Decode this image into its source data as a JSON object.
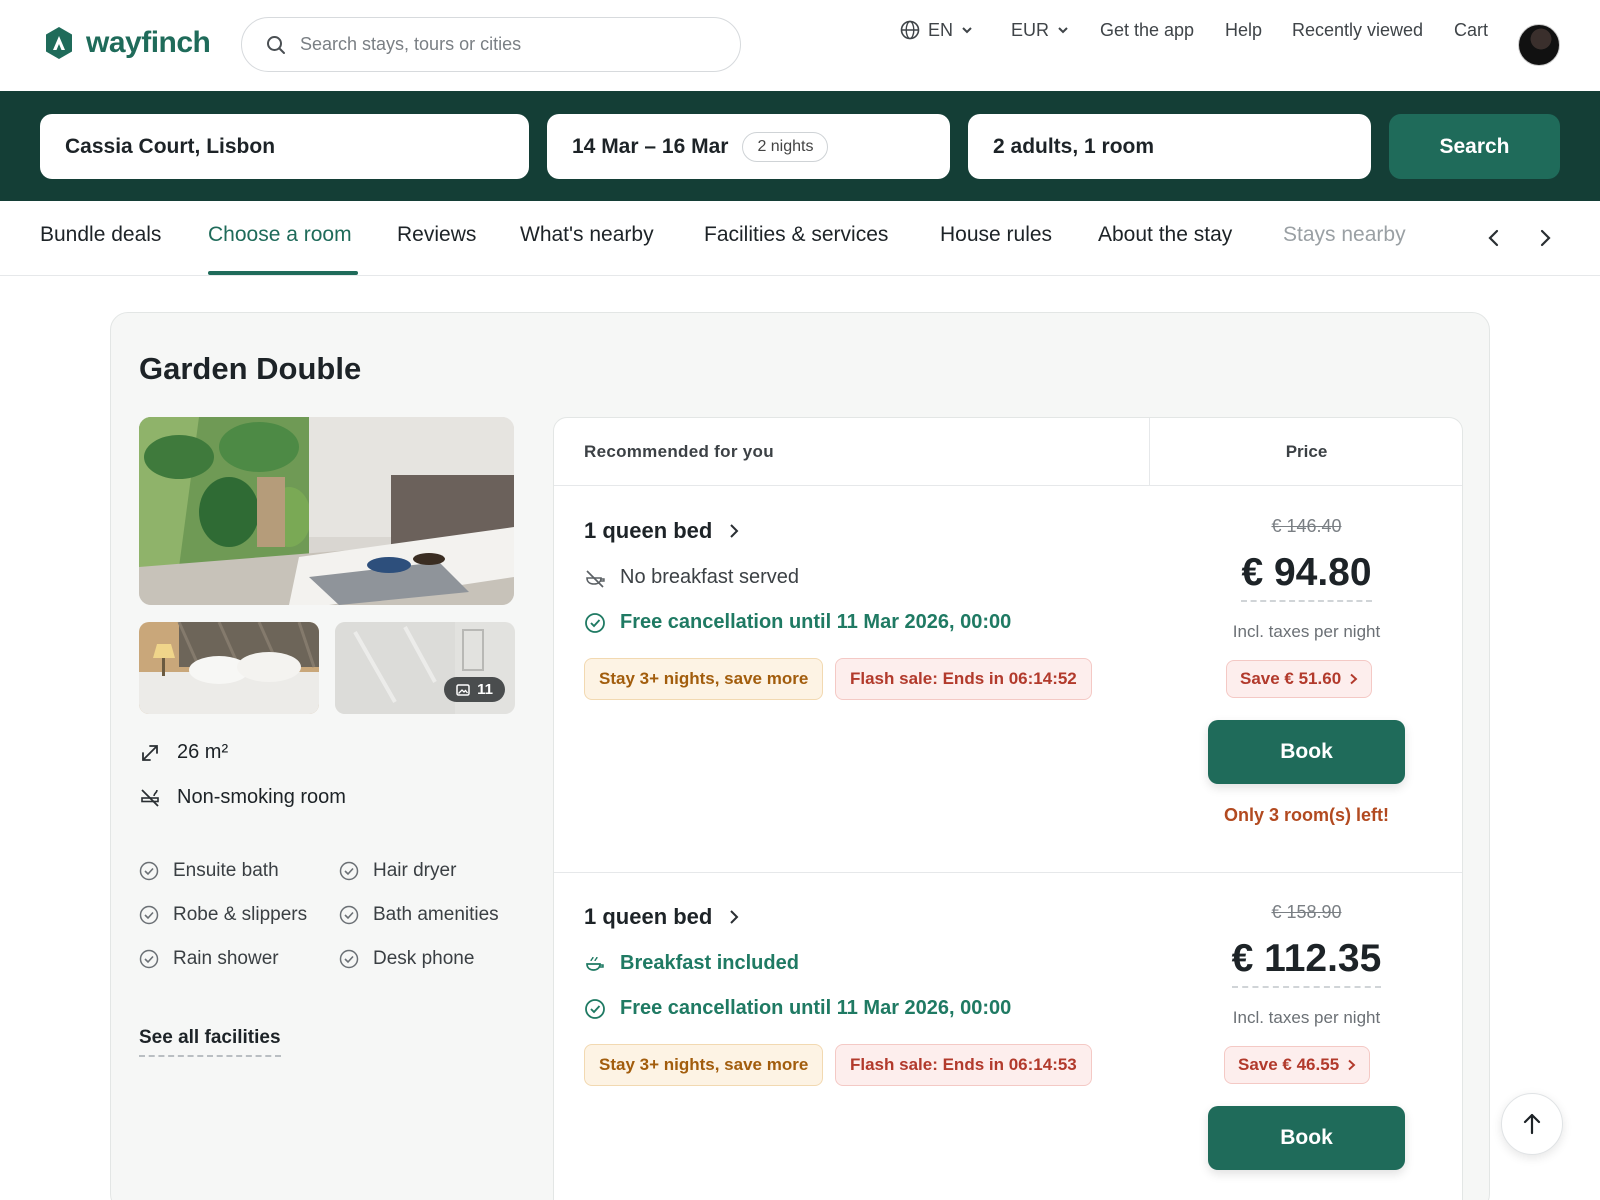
{
  "brand": {
    "name": "wayfinch",
    "color": "#1f6b5a"
  },
  "search": {
    "placeholder": "Search stays, tours or cities"
  },
  "top_nav": {
    "language": "EN",
    "currency": "EUR",
    "get_app": "Get the app",
    "help": "Help",
    "recently_viewed": "Recently viewed",
    "cart": "Cart"
  },
  "booking_bar": {
    "location": "Cassia Court, Lisbon",
    "dates": "14 Mar – 16 Mar",
    "nights": "2 nights",
    "guests": "2 adults, 1 room",
    "search_label": "Search"
  },
  "tabs": [
    {
      "label": "Bundle deals",
      "active": false
    },
    {
      "label": "Choose a room",
      "active": true
    },
    {
      "label": "Reviews",
      "active": false
    },
    {
      "label": "What's nearby",
      "active": false
    },
    {
      "label": "Facilities & services",
      "active": false
    },
    {
      "label": "House rules",
      "active": false
    },
    {
      "label": "About the stay",
      "active": false
    },
    {
      "label": "Stays nearby",
      "active": false
    }
  ],
  "room": {
    "title": "Garden Double",
    "photo_count": "11",
    "size": "26 m²",
    "smoking": "Non-smoking room",
    "facilities": [
      "Ensuite bath",
      "Hair dryer",
      "Robe & slippers",
      "Bath amenities",
      "Rain shower",
      "Desk phone"
    ],
    "see_all": "See all facilities"
  },
  "offers_header": {
    "recommended": "Recommended for you",
    "price": "Price"
  },
  "offers": [
    {
      "bed": "1 queen bed",
      "breakfast": "No breakfast served",
      "breakfast_included": false,
      "cancellation": "Free cancellation until 11 Mar 2026, 00:00",
      "tag_stay": "Stay 3+ nights, save more",
      "tag_flash": "Flash sale: Ends in 06:14:52",
      "old_price": "€ 146.40",
      "price": "€ 94.80",
      "incl": "Incl. taxes per night",
      "save": "Save € 51.60",
      "book": "Book",
      "availability": "Only 3 room(s) left!"
    },
    {
      "bed": "1 queen bed",
      "breakfast": "Breakfast included",
      "breakfast_included": true,
      "cancellation": "Free cancellation until 11 Mar 2026, 00:00",
      "tag_stay": "Stay 3+ nights, save more",
      "tag_flash": "Flash sale: Ends in 06:14:53",
      "old_price": "€ 158.90",
      "price": "€ 112.35",
      "incl": "Incl. taxes per night",
      "save": "Save € 46.55",
      "book": "Book"
    }
  ],
  "colors": {
    "dark_strip": "#143e36",
    "accent_green": "#1f6b5a",
    "sale_red": "#b23a2c",
    "amber": "#a25d0d"
  }
}
